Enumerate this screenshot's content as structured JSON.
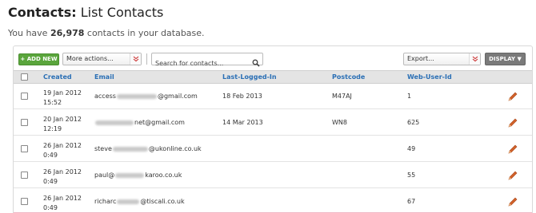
{
  "header": {
    "title_bold": "Contacts:",
    "title_rest": " List Contacts",
    "summary_pre": "You have ",
    "summary_count": "26,978",
    "summary_post": " contacts in your database."
  },
  "toolbar": {
    "add_label": "+ ADD NEW",
    "more_actions": "More actions...",
    "search_placeholder": "Search for contacts...",
    "export": "Export...",
    "display_label": "DISPLAY ▼"
  },
  "table": {
    "columns": [
      "Created",
      "Email",
      "Last-Logged-In",
      "Postcode",
      "Web-User-Id"
    ],
    "rows": [
      {
        "created_date": "19 Jan 2012",
        "created_time": "15:52",
        "email_pre": "access",
        "email_post": "@gmail.com",
        "last_login": "18 Feb 2013",
        "postcode": "M47AJ",
        "web_user_id": "1"
      },
      {
        "created_date": "20 Jan 2012",
        "created_time": "12:19",
        "email_pre": "",
        "email_post": "net@gmail.com",
        "last_login": "14 Mar 2013",
        "postcode": "WN8",
        "web_user_id": "625"
      },
      {
        "created_date": "26 Jan 2012",
        "created_time": "0:49",
        "email_pre": "steve",
        "email_post": "@ukonline.co.uk",
        "last_login": "",
        "postcode": "",
        "web_user_id": "49"
      },
      {
        "created_date": "26 Jan 2012",
        "created_time": "0:49",
        "email_pre": "paul@",
        "email_post": "karoo.co.uk",
        "last_login": "",
        "postcode": "",
        "web_user_id": "55"
      },
      {
        "created_date": "26 Jan 2012",
        "created_time": "0:49",
        "email_pre": "richarc",
        "email_post": "@tiscali.co.uk",
        "last_login": "",
        "postcode": "",
        "web_user_id": "67"
      }
    ]
  },
  "colors": {
    "add_button": "#5aa53c",
    "display_button": "#7a7a7a",
    "header_link": "#2a6fb5",
    "edit_icon": "#d2622a",
    "dropdown_chevron": "#cc3333"
  }
}
